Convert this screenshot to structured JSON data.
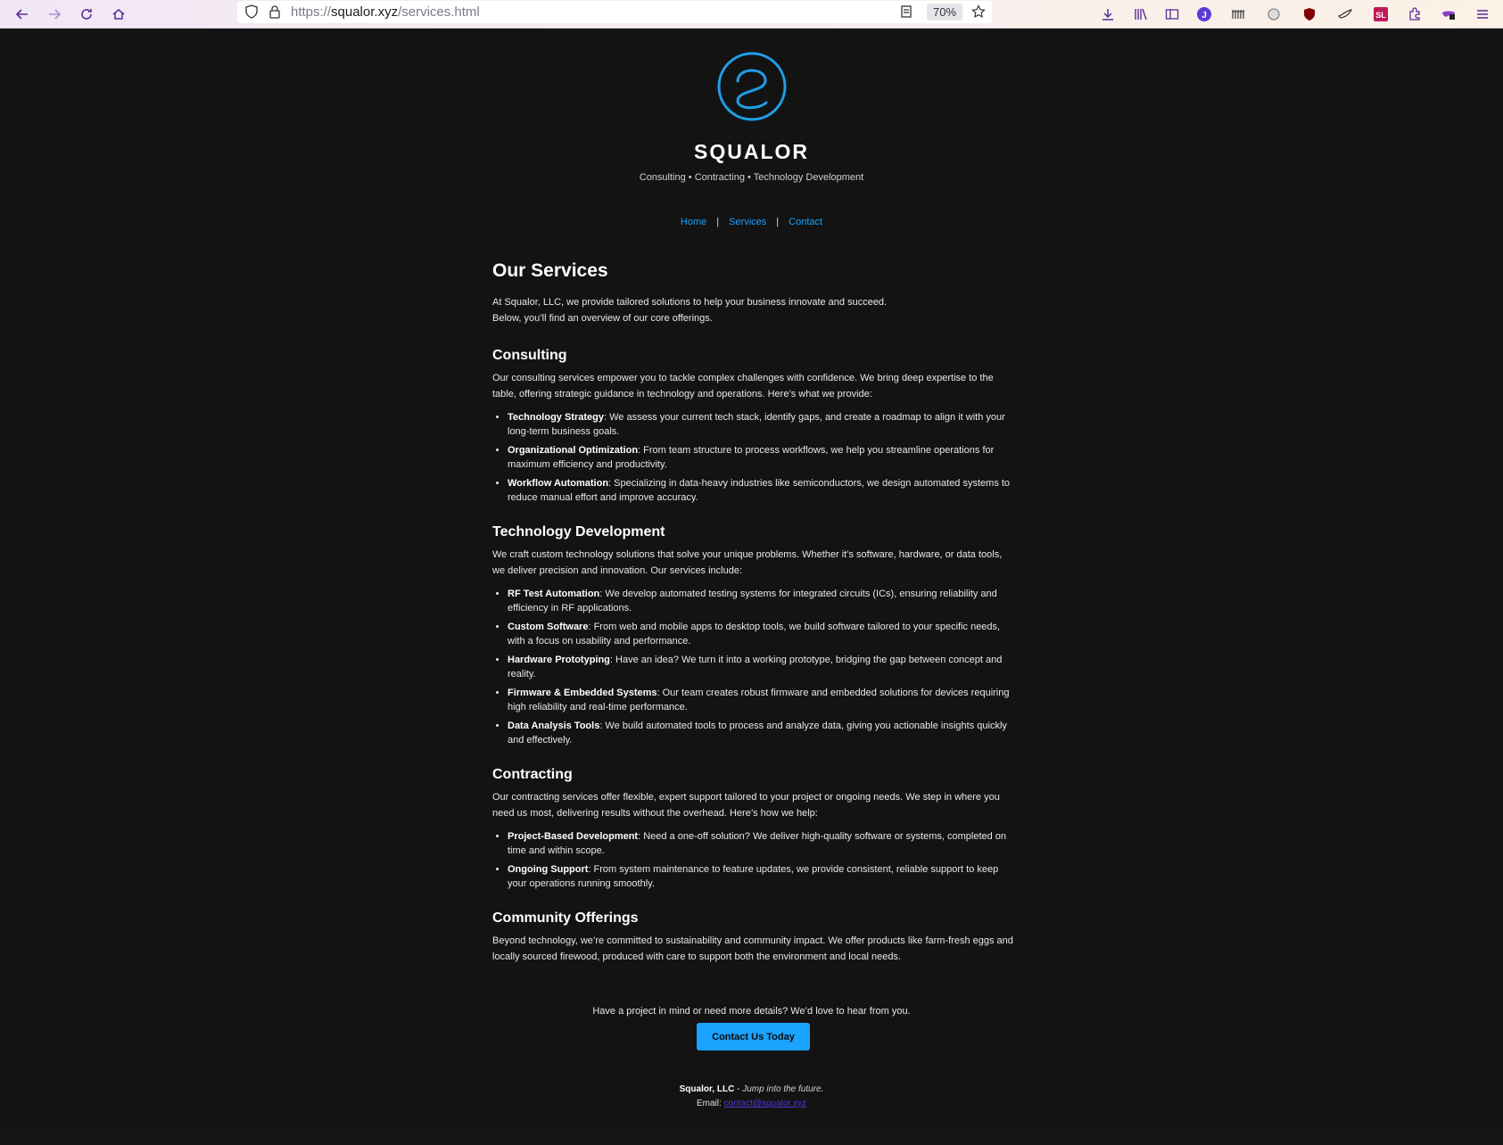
{
  "browser": {
    "url_scheme": "https://",
    "url_host": "squalor.xyz",
    "url_path": "/services.html",
    "zoom_level": "70%"
  },
  "header": {
    "brand": "SQUALOR",
    "tagline": "Consulting • Contracting • Technology Development",
    "logo_color": "#1e9fe8"
  },
  "nav": {
    "items": [
      {
        "label": "Home"
      },
      {
        "label": "Services"
      },
      {
        "label": "Contact"
      }
    ],
    "separator": "|"
  },
  "main": {
    "title": "Our Services",
    "intro_line1": "At Squalor, LLC, we provide tailored solutions to help your business innovate and succeed.",
    "intro_line2": "Below, you’ll find an overview of our core offerings.",
    "sections": [
      {
        "heading": "Consulting",
        "text": "Our consulting services empower you to tackle complex challenges with confidence. We bring deep expertise to the table, offering strategic guidance in technology and operations. Here’s what we provide:",
        "items": [
          {
            "term": "Technology Strategy",
            "desc": ": We assess your current tech stack, identify gaps, and create a roadmap to align it with your long-term business goals."
          },
          {
            "term": "Organizational Optimization",
            "desc": ": From team structure to process workflows, we help you streamline operations for maximum efficiency and productivity."
          },
          {
            "term": "Workflow Automation",
            "desc": ": Specializing in data-heavy industries like semiconductors, we design automated systems to reduce manual effort and improve accuracy."
          }
        ]
      },
      {
        "heading": "Technology Development",
        "text": "We craft custom technology solutions that solve your unique problems. Whether it’s software, hardware, or data tools, we deliver precision and innovation. Our services include:",
        "items": [
          {
            "term": "RF Test Automation",
            "desc": ": We develop automated testing systems for integrated circuits (ICs), ensuring reliability and efficiency in RF applications."
          },
          {
            "term": "Custom Software",
            "desc": ": From web and mobile apps to desktop tools, we build software tailored to your specific needs, with a focus on usability and performance."
          },
          {
            "term": "Hardware Prototyping",
            "desc": ": Have an idea? We turn it into a working prototype, bridging the gap between concept and reality."
          },
          {
            "term": "Firmware & Embedded Systems",
            "desc": ": Our team creates robust firmware and embedded solutions for devices requiring high reliability and real-time performance."
          },
          {
            "term": "Data Analysis Tools",
            "desc": ": We build automated tools to process and analyze data, giving you actionable insights quickly and effectively."
          }
        ]
      },
      {
        "heading": "Contracting",
        "text": "Our contracting services offer flexible, expert support tailored to your project or ongoing needs. We step in where you need us most, delivering results without the overhead. Here’s how we help:",
        "items": [
          {
            "term": "Project-Based Development",
            "desc": ": Need a one-off solution? We deliver high-quality software or systems, completed on time and within scope."
          },
          {
            "term": "Ongoing Support",
            "desc": ": From system maintenance to feature updates, we provide consistent, reliable support to keep your operations running smoothly."
          }
        ]
      },
      {
        "heading": "Community Offerings",
        "text": "Beyond technology, we’re committed to sustainability and community impact. We offer products like farm-fresh eggs and locally sourced firewood, produced with care to support both the environment and local needs."
      }
    ]
  },
  "cta": {
    "text": "Have a project in mind or need more details? We’d love to hear from you.",
    "button_label": "Contact Us Today",
    "button_color": "#1aa3ff"
  },
  "footer": {
    "company": "Squalor, LLC",
    "dash": " - ",
    "slogan": "Jump into the future.",
    "email_label": "Email: ",
    "email": "contact@squalor.xyz"
  }
}
